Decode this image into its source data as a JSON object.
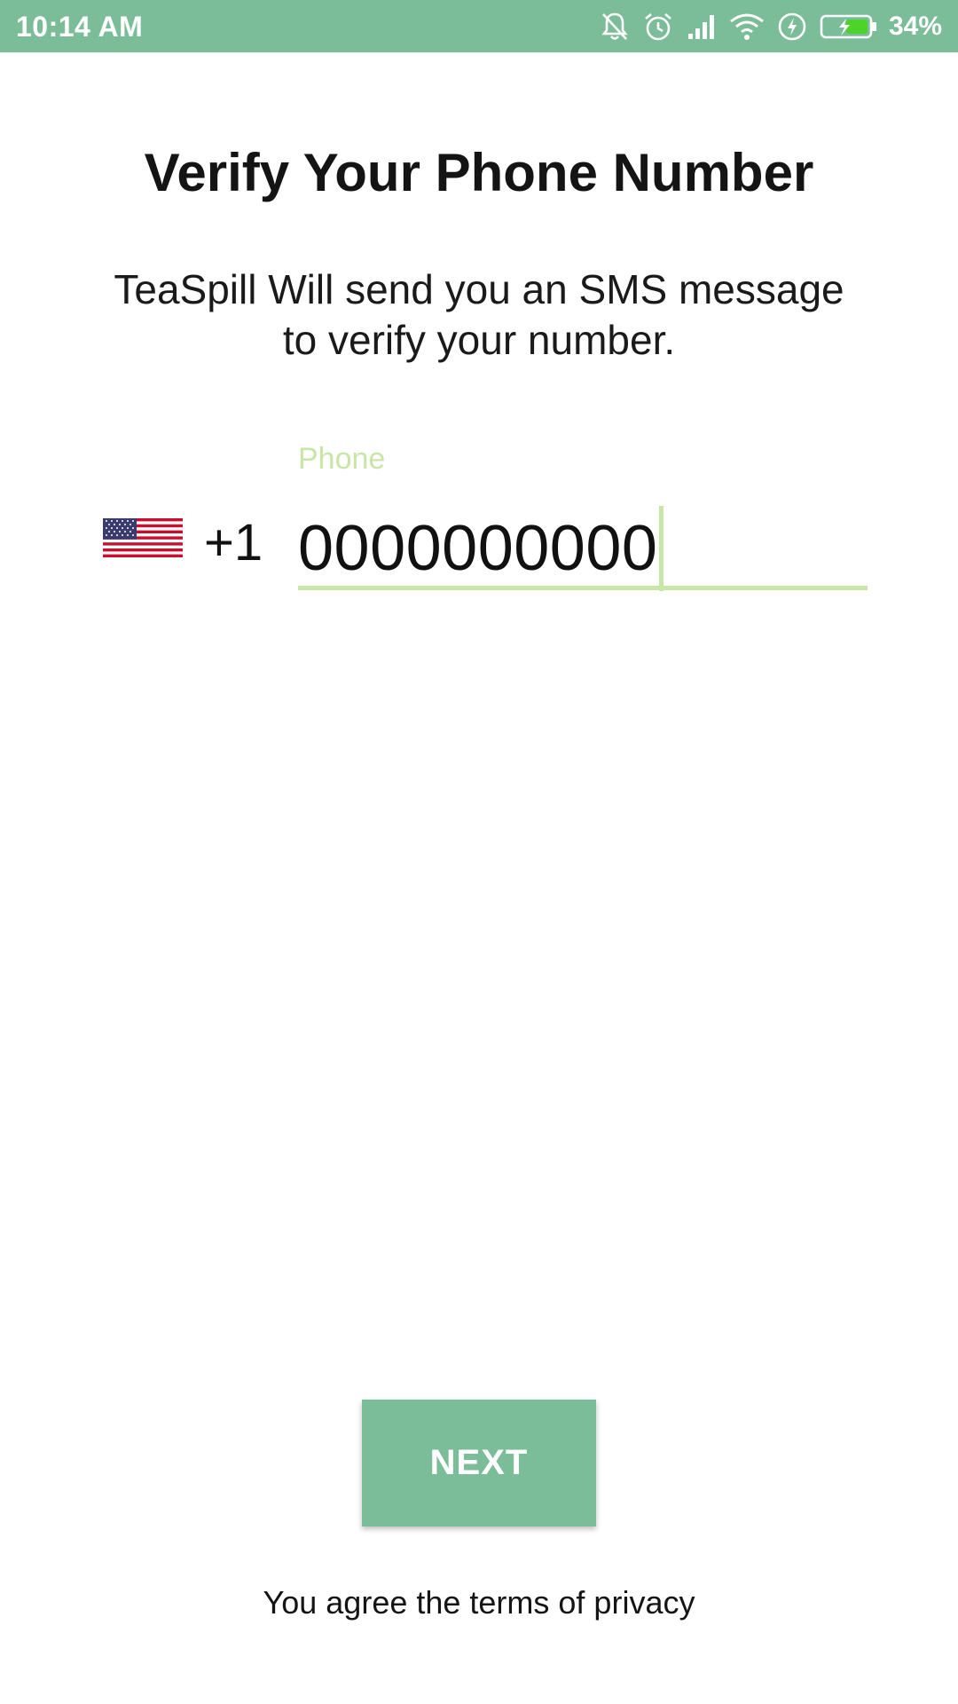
{
  "status_bar": {
    "time": "10:14 AM",
    "battery_percent": "34%",
    "background_color": "#7bbd98",
    "icons": [
      "notifications-muted-icon",
      "alarm-icon",
      "signal-icon",
      "wifi-icon",
      "flash-icon",
      "battery-charging-icon"
    ]
  },
  "main": {
    "title": "Verify Your Phone Number",
    "subtitle_line1": "TeaSpill Will send you an SMS message",
    "subtitle_line2": "to verify your number."
  },
  "phone": {
    "country_flag": "us-flag-icon",
    "country_code": "+1",
    "label": "Phone",
    "value": "0000000000",
    "accent_color": "#c9e6a8"
  },
  "actions": {
    "next_label": "NEXT",
    "button_color": "#7bbd98"
  },
  "footer": {
    "terms_text": "You agree the terms of privacy"
  }
}
